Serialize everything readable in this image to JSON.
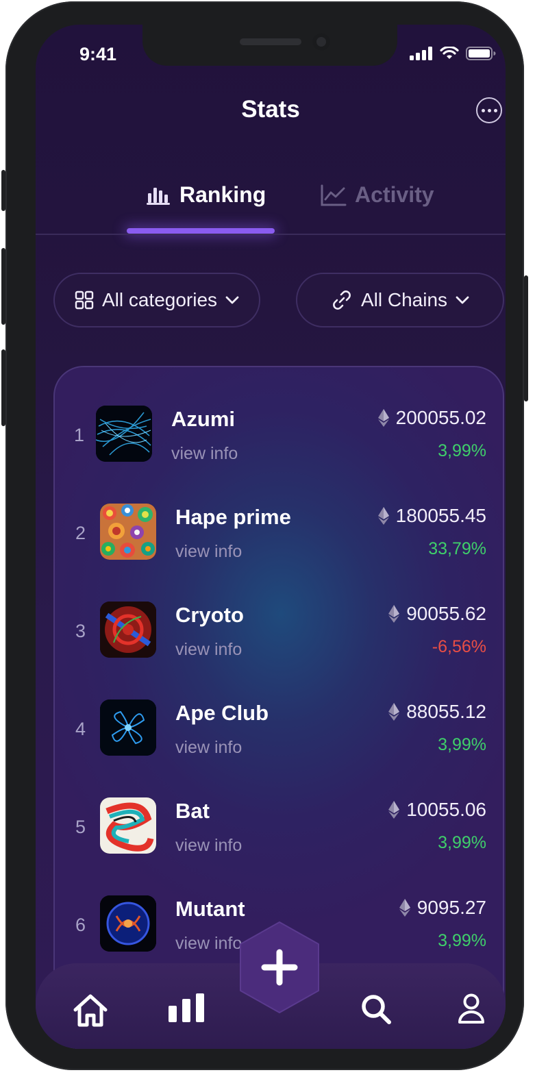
{
  "status_bar": {
    "time": "9:41"
  },
  "header": {
    "title": "Stats"
  },
  "tabs": [
    {
      "label": "Ranking",
      "icon": "bar-chart-icon",
      "active": true
    },
    {
      "label": "Activity",
      "icon": "line-chart-icon",
      "active": false
    }
  ],
  "filters": {
    "categories": {
      "label": "All categories",
      "icon": "grid-icon"
    },
    "chains": {
      "label": "All Chains",
      "icon": "link-icon"
    }
  },
  "rows": [
    {
      "rank": "1",
      "name": "Azumi",
      "link": "view info",
      "price": "200055.02",
      "change": "3,99%",
      "trend": "up"
    },
    {
      "rank": "2",
      "name": "Hape prime",
      "link": "view info",
      "price": "180055.45",
      "change": "33,79%",
      "trend": "up"
    },
    {
      "rank": "3",
      "name": "Cryoto",
      "link": "view info",
      "price": "90055.62",
      "change": "-6,56%",
      "trend": "down"
    },
    {
      "rank": "4",
      "name": "Ape Club",
      "link": "view info",
      "price": "88055.12",
      "change": "3,99%",
      "trend": "up"
    },
    {
      "rank": "5",
      "name": "Bat",
      "link": "view info",
      "price": "10055.06",
      "change": "3,99%",
      "trend": "up"
    },
    {
      "rank": "6",
      "name": "Mutant",
      "link": "view info",
      "price": "9095.27",
      "change": "3,99%",
      "trend": "up"
    }
  ],
  "colors": {
    "accent": "#8a5cf0",
    "positive": "#3fcf6a",
    "negative": "#e94e45"
  },
  "nav": [
    "home-icon",
    "stats-icon",
    "add-icon",
    "search-icon",
    "profile-icon"
  ]
}
